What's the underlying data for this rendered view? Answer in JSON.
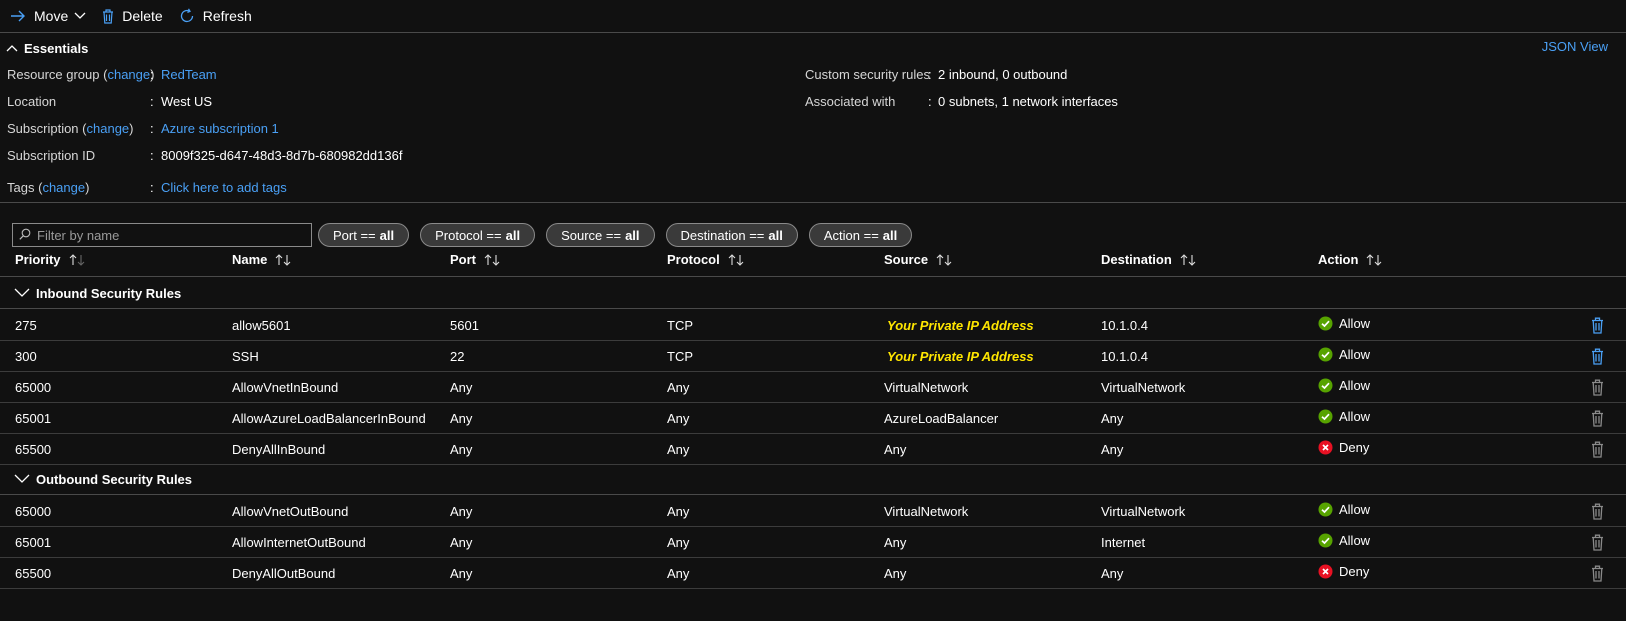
{
  "toolbar": {
    "move_label": "Move",
    "delete_label": "Delete",
    "refresh_label": "Refresh"
  },
  "essentials": {
    "title": "Essentials",
    "json_view": "JSON View",
    "left": {
      "resource_group_label": "Resource group",
      "resource_group_change": "change",
      "resource_group_value": "RedTeam",
      "location_label": "Location",
      "location_value": "West US",
      "subscription_label": "Subscription",
      "subscription_change": "change",
      "subscription_value": "Azure subscription 1",
      "subscription_id_label": "Subscription ID",
      "subscription_id_value": "8009f325-d647-48d3-8d7b-680982dd136f",
      "tags_label": "Tags",
      "tags_change": "change",
      "tags_value": "Click here to add tags"
    },
    "right": {
      "custom_rules_label": "Custom security rules",
      "custom_rules_value": "2 inbound, 0 outbound",
      "associated_label": "Associated with",
      "associated_value": "0 subnets, 1 network interfaces"
    }
  },
  "filters": {
    "search_placeholder": "Filter by name",
    "pills": [
      {
        "label": "Port ==",
        "value": "all"
      },
      {
        "label": "Protocol ==",
        "value": "all"
      },
      {
        "label": "Source ==",
        "value": "all"
      },
      {
        "label": "Destination ==",
        "value": "all"
      },
      {
        "label": "Action ==",
        "value": "all"
      }
    ]
  },
  "table": {
    "columns": [
      "Priority",
      "Name",
      "Port",
      "Protocol",
      "Source",
      "Destination",
      "Action"
    ],
    "inbound_title": "Inbound Security Rules",
    "outbound_title": "Outbound Security Rules",
    "inbound": [
      {
        "priority": "275",
        "name": "allow5601",
        "port": "5601",
        "protocol": "TCP",
        "source": "Your Private IP Address",
        "destination": "10.1.0.4",
        "action": "Allow"
      },
      {
        "priority": "300",
        "name": "SSH",
        "port": "22",
        "protocol": "TCP",
        "source": "Your Private IP Address",
        "destination": "10.1.0.4",
        "action": "Allow"
      },
      {
        "priority": "65000",
        "name": "AllowVnetInBound",
        "port": "Any",
        "protocol": "Any",
        "source": "VirtualNetwork",
        "destination": "VirtualNetwork",
        "action": "Allow"
      },
      {
        "priority": "65001",
        "name": "AllowAzureLoadBalancerInBound",
        "port": "Any",
        "protocol": "Any",
        "source": "AzureLoadBalancer",
        "destination": "Any",
        "action": "Allow"
      },
      {
        "priority": "65500",
        "name": "DenyAllInBound",
        "port": "Any",
        "protocol": "Any",
        "source": "Any",
        "destination": "Any",
        "action": "Deny"
      }
    ],
    "outbound": [
      {
        "priority": "65000",
        "name": "AllowVnetOutBound",
        "port": "Any",
        "protocol": "Any",
        "source": "VirtualNetwork",
        "destination": "VirtualNetwork",
        "action": "Allow"
      },
      {
        "priority": "65001",
        "name": "AllowInternetOutBound",
        "port": "Any",
        "protocol": "Any",
        "source": "Any",
        "destination": "Internet",
        "action": "Allow"
      },
      {
        "priority": "65500",
        "name": "DenyAllOutBound",
        "port": "Any",
        "protocol": "Any",
        "source": "Any",
        "destination": "Any",
        "action": "Deny"
      }
    ]
  },
  "colors": {
    "link": "#4aa0f5",
    "allow": "#57a300",
    "deny": "#e81123",
    "highlight": "#ffe600",
    "background": "#111111"
  }
}
